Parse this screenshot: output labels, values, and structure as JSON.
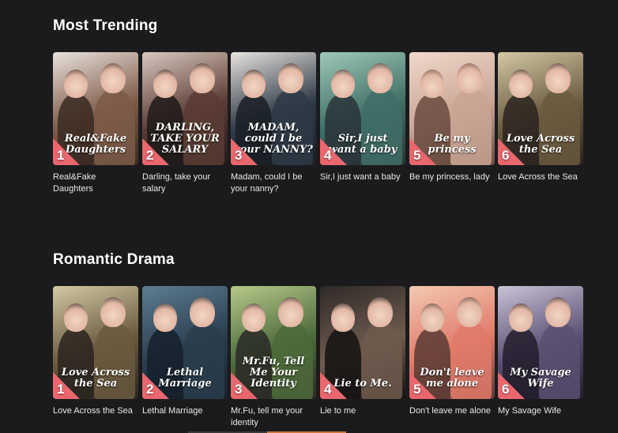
{
  "sections": [
    {
      "title": "Most Trending",
      "items": [
        {
          "rank": "1",
          "title": "Real&Fake Daughters",
          "poster_text": "Real&Fake Daughters",
          "colors": [
            "#e9e2dc",
            "#7d5a48",
            "#3a2a22"
          ]
        },
        {
          "rank": "2",
          "title": "Darling, take your salary",
          "poster_text": "DARLING, TAKE YOUR SALARY",
          "colors": [
            "#d8c8c0",
            "#5b3c34",
            "#1f1a1a"
          ]
        },
        {
          "rank": "3",
          "title": "Madam, could I be your nanny?",
          "poster_text": "MADAM, could I be your NANNY?",
          "colors": [
            "#e8e4e0",
            "#2f3a46",
            "#1a1e24"
          ]
        },
        {
          "rank": "4",
          "title": "Sir,I just want a baby",
          "poster_text": "Sir,I just want a baby",
          "colors": [
            "#9fc9b8",
            "#3f6f66",
            "#2a3438"
          ]
        },
        {
          "rank": "5",
          "title": "Be my princess, lady",
          "poster_text": "Be my princess",
          "colors": [
            "#f1d9cc",
            "#c9a594",
            "#6a4a40"
          ]
        },
        {
          "rank": "6",
          "title": "Love Across the Sea",
          "poster_text": "Love Across the Sea",
          "colors": [
            "#d2c9a5",
            "#6a5a3e",
            "#2a2420"
          ]
        }
      ]
    },
    {
      "title": "Romantic Drama",
      "items": [
        {
          "rank": "1",
          "title": "Love Across the Sea",
          "poster_text": "Love Across the Sea",
          "colors": [
            "#d2c9a5",
            "#6a5a3e",
            "#2a2420"
          ]
        },
        {
          "rank": "2",
          "title": "Lethal Marriage",
          "poster_text": "Lethal Marriage",
          "colors": [
            "#5d7d92",
            "#2a3d4c",
            "#15202a"
          ]
        },
        {
          "rank": "3",
          "title": "Mr.Fu, tell me your identity",
          "poster_text": "Mr.Fu, Tell Me Your Identity",
          "colors": [
            "#b6c98a",
            "#4d6a3a",
            "#2a2a26"
          ]
        },
        {
          "rank": "4",
          "title": "Lie to me",
          "poster_text": "Lie to Me.",
          "colors": [
            "#2e2a28",
            "#6f5b4e",
            "#141212"
          ]
        },
        {
          "rank": "5",
          "title": "Don't leave me alone",
          "poster_text": "Don't leave me alone",
          "colors": [
            "#f3c9b0",
            "#e07a6a",
            "#5a3a34"
          ]
        },
        {
          "rank": "6",
          "title": "My Savage Wife",
          "poster_text": "My Savage Wife",
          "colors": [
            "#c9c3d6",
            "#5a4f72",
            "#221d2c"
          ]
        }
      ]
    }
  ],
  "accent_color": "#e9676d"
}
